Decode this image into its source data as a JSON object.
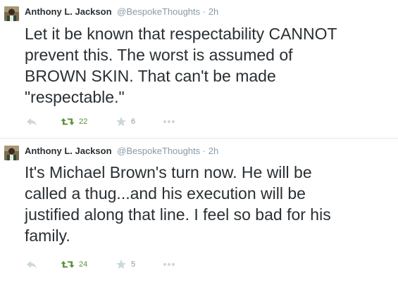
{
  "colors": {
    "text": "#292f33",
    "muted": "#8899a6",
    "retweet_green": "#5c913b",
    "icon_gray": "#ccd6dd",
    "divider": "#e1e8ed"
  },
  "tweets": [
    {
      "author_name": "Anthony L. Jackson",
      "handle": "@BespokeThoughts",
      "separator": "·",
      "time": "2h",
      "lines": [
        "Let it be known that respectability CANNOT",
        "prevent this. The worst is assumed of",
        "BROWN SKIN. That can't be made",
        "\"respectable.\""
      ],
      "actions": {
        "reply_icon": "reply-icon",
        "retweet_icon": "retweet-icon",
        "retweet_count": "22",
        "favorite_icon": "star-icon",
        "favorite_count": "6",
        "more_icon": "more-icon"
      }
    },
    {
      "author_name": "Anthony L. Jackson",
      "handle": "@BespokeThoughts",
      "separator": "·",
      "time": "2h",
      "lines": [
        "It's Michael Brown's turn now. He will be",
        "called a thug...and his execution will be",
        "justified along that line. I feel so bad for his",
        "family."
      ],
      "actions": {
        "reply_icon": "reply-icon",
        "retweet_icon": "retweet-icon",
        "retweet_count": "24",
        "favorite_icon": "star-icon",
        "favorite_count": "5",
        "more_icon": "more-icon"
      }
    }
  ]
}
